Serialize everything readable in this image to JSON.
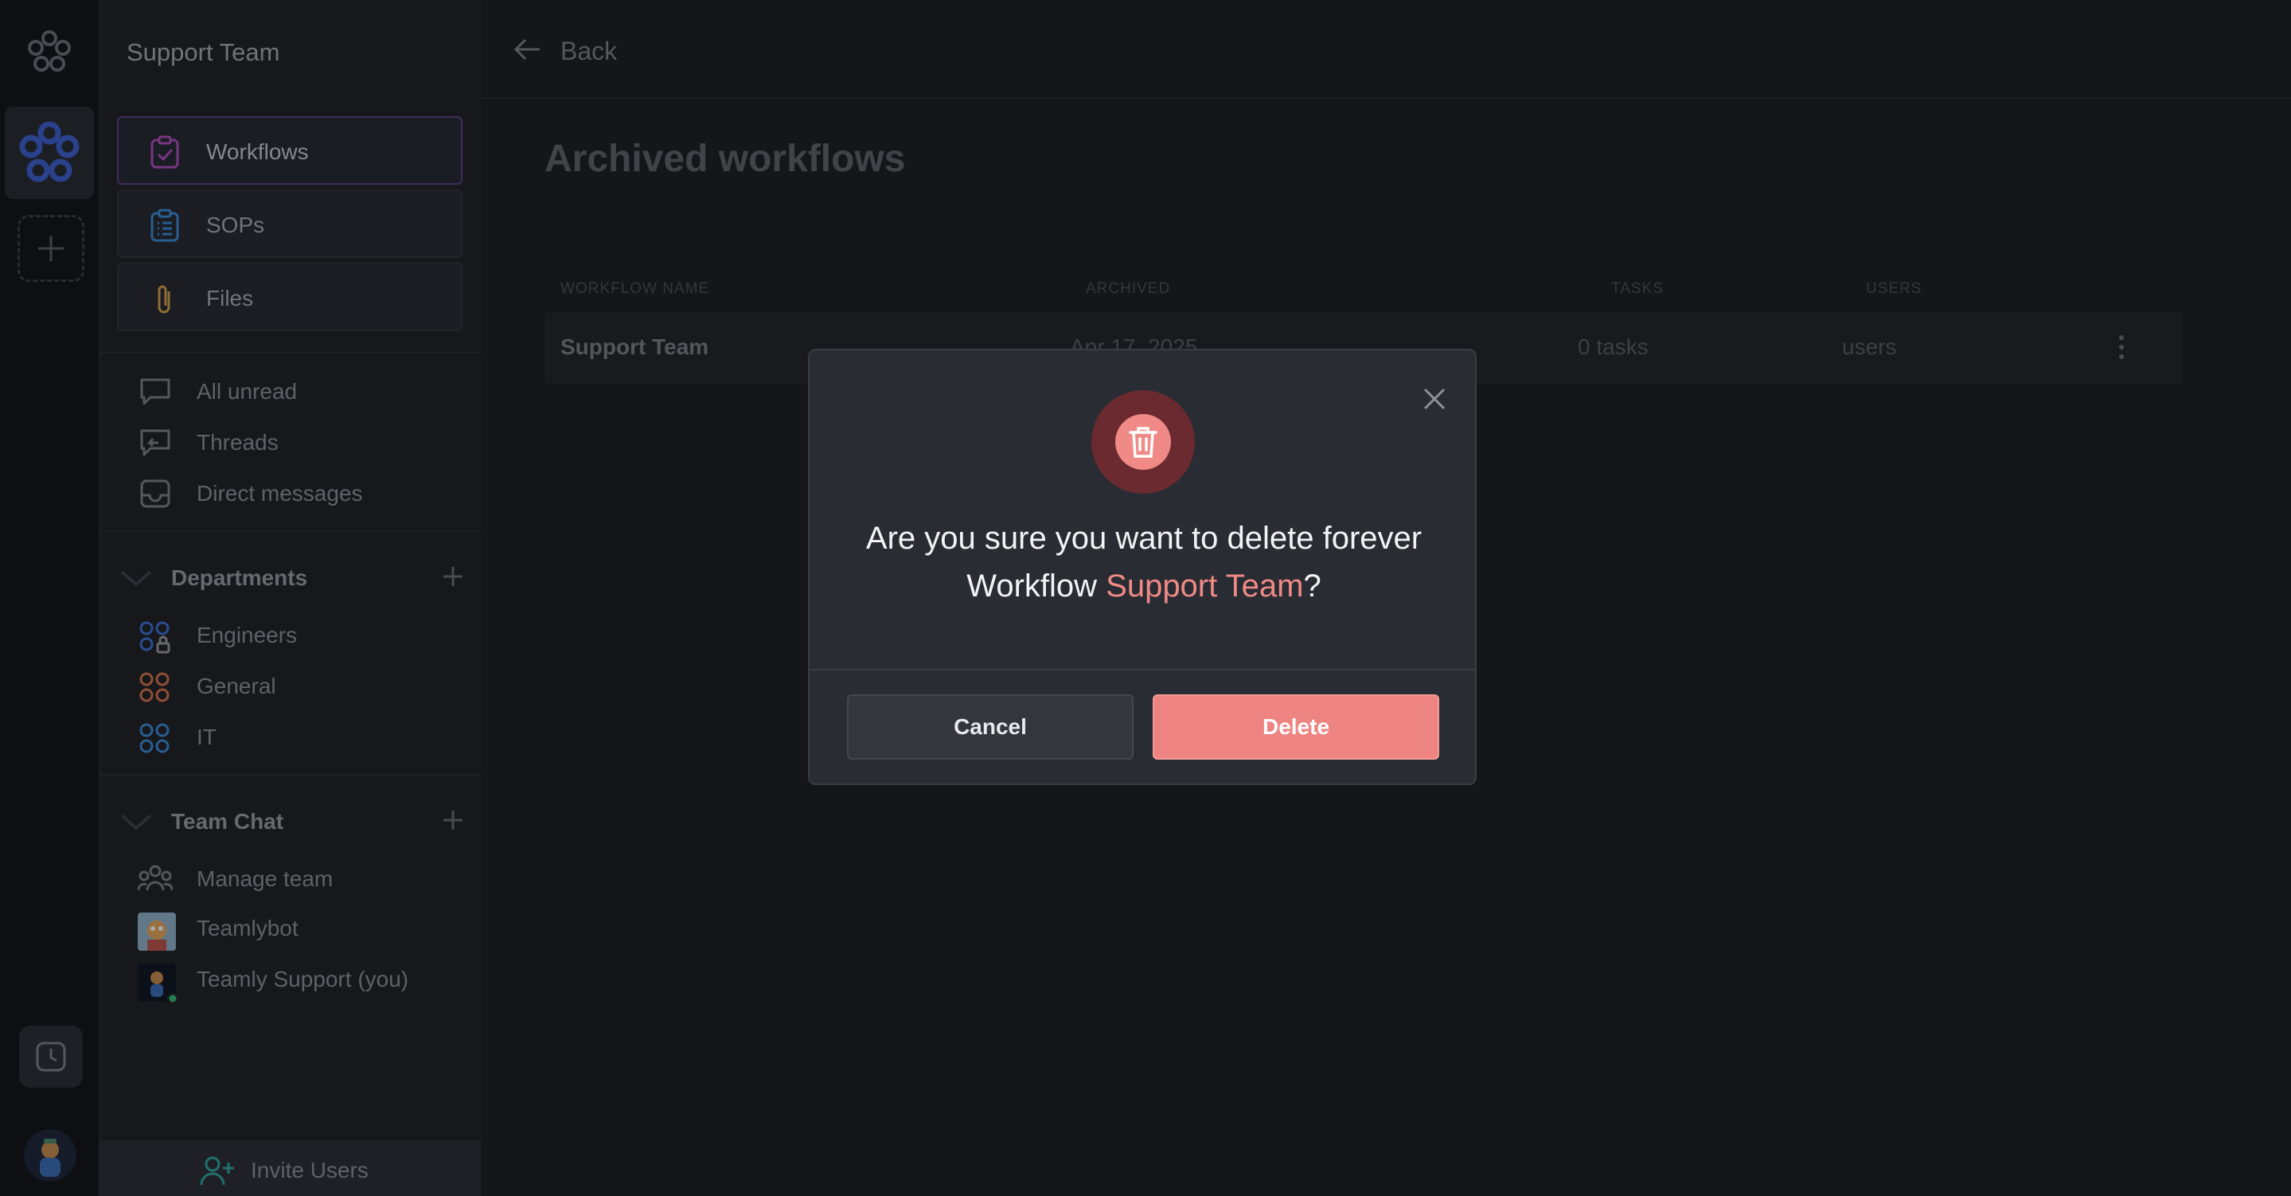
{
  "sidebar": {
    "team_name": "Support Team",
    "nav": [
      {
        "label": "Workflows",
        "icon": "clipboard-check-icon",
        "color": "#b44cc2"
      },
      {
        "label": "SOPs",
        "icon": "clipboard-list-icon",
        "color": "#3a8ad6"
      },
      {
        "label": "Files",
        "icon": "paperclip-icon",
        "color": "#d8a24a"
      }
    ],
    "items": [
      {
        "label": "All unread",
        "icon": "chat-bubble-icon"
      },
      {
        "label": "Threads",
        "icon": "threads-icon"
      },
      {
        "label": "Direct messages",
        "icon": "inbox-icon"
      }
    ],
    "departments": {
      "title": "Departments",
      "items": [
        {
          "label": "Engineers",
          "color": "#3f6fd8"
        },
        {
          "label": "General",
          "color": "#d8744a"
        },
        {
          "label": "IT",
          "color": "#3a8ad6"
        }
      ]
    },
    "team_chat": {
      "title": "Team Chat",
      "items": [
        {
          "label": "Manage team"
        },
        {
          "label": "Teamlybot"
        },
        {
          "label": "Teamly Support (you)"
        }
      ]
    },
    "invite_label": "Invite Users"
  },
  "main": {
    "back_label": "Back",
    "title": "Archived workflows",
    "columns": [
      "WORKFLOW NAME",
      "ARCHIVED",
      "TASKS",
      "USERS"
    ],
    "rows": [
      {
        "name": "Support Team",
        "archived": "Apr 17, 2025",
        "tasks": "0 tasks",
        "users": "users"
      }
    ]
  },
  "modal": {
    "question_line1": "Are you sure you want to delete forever",
    "question_prefix": "Workflow ",
    "highlight": "Support Team",
    "question_suffix": "?",
    "cancel_label": "Cancel",
    "delete_label": "Delete",
    "accent_color": "#f08a86"
  }
}
